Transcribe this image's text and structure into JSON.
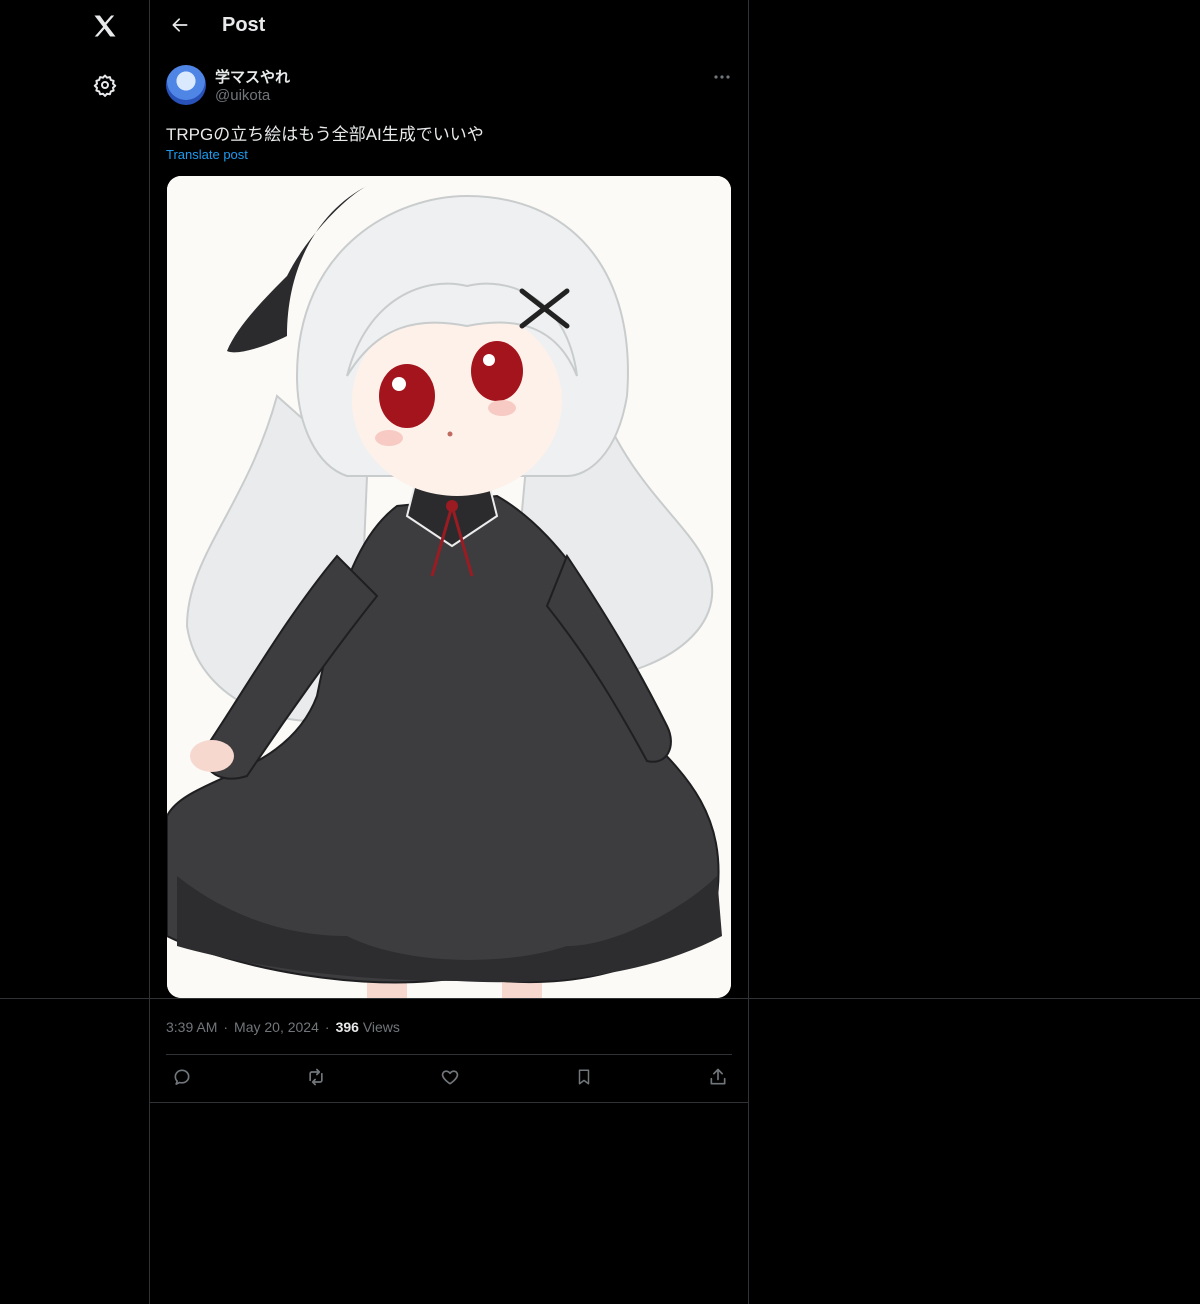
{
  "nav": {
    "logo_icon": "x-logo-icon",
    "settings_icon": "gear-icon"
  },
  "header": {
    "title": "Post",
    "back_icon": "arrow-left-icon"
  },
  "post": {
    "author_name": "学マスやれ",
    "author_handle": "@uikota",
    "text": "TRPGの立ち絵はもう全部AI生成でいいや",
    "translate_label": "Translate post",
    "time": "3:39 AM",
    "date": "May 20, 2024",
    "separator": "·",
    "views_count": "396",
    "views_label": "Views"
  },
  "colors": {
    "background": "#000000",
    "border": "#2f3336",
    "accent": "#1d9bf0",
    "muted": "#71767b"
  },
  "actions": [
    "reply-icon",
    "repost-icon",
    "like-icon",
    "bookmark-icon",
    "share-icon"
  ]
}
